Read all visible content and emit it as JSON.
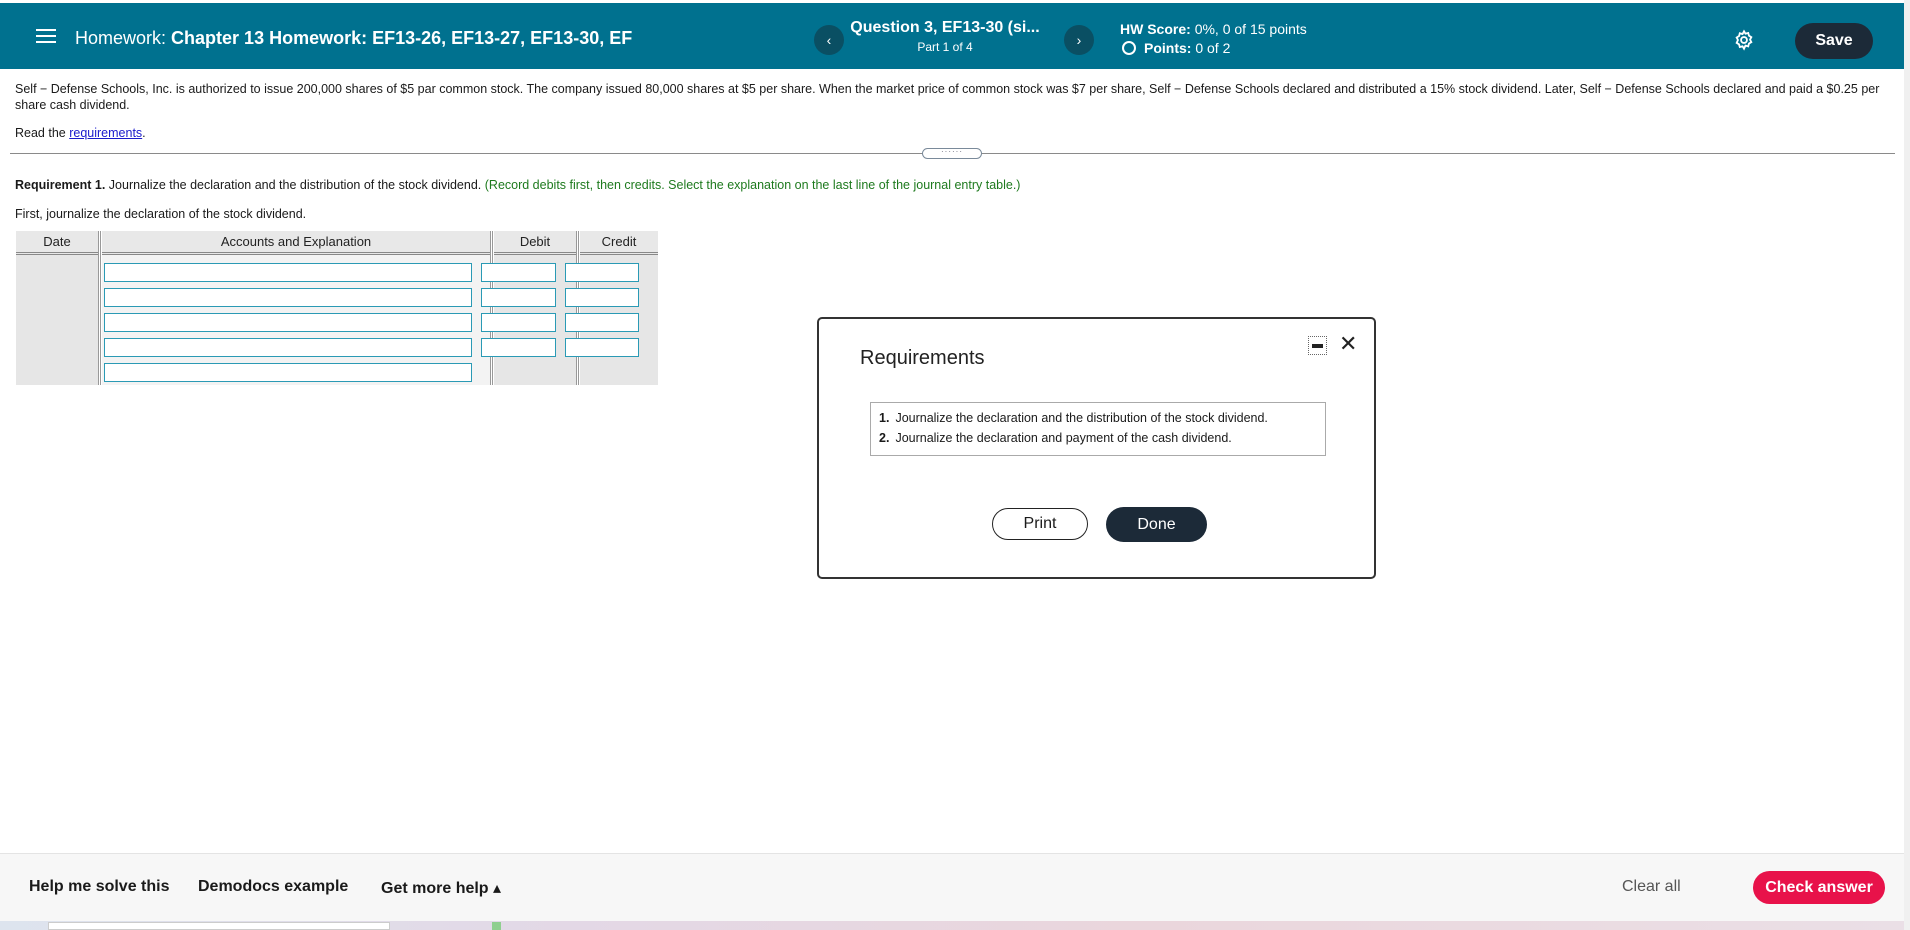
{
  "header": {
    "homework_label": "Homework:",
    "homework_title": "Chapter 13 Homework: EF13-26, EF13-27, EF13-30, EF",
    "prev_label": "‹",
    "next_label": "›",
    "question_title": "Question 3, EF13-30 (si...",
    "question_part": "Part 1 of 4",
    "hw_score_label": "HW Score:",
    "hw_score_value": "0%, 0 of 15 points",
    "points_label": "Points:",
    "points_value": "0 of 2",
    "save_label": "Save"
  },
  "problem": {
    "text": "Self − Defense Schools, Inc. is authorized to issue 200,000 shares of $5 par common stock. The company issued 80,000 shares at $5 per share. When the market price of common stock was $7 per share, Self − Defense Schools declared and distributed a 15% stock dividend. Later, Self − Defense Schools declared and paid a $0.25 per share cash dividend.",
    "read_prefix": "Read the",
    "read_link": "requirements",
    "read_suffix": ".",
    "drag_handle": "······"
  },
  "requirement1": {
    "label": "Requirement 1.",
    "text": "Journalize the declaration and the distribution of the stock dividend.",
    "hint": "(Record debits first, then credits. Select the explanation on the last line of the journal entry table.)",
    "first_line": "First, journalize the declaration of the stock dividend."
  },
  "journal": {
    "headers": {
      "date": "Date",
      "accounts": "Accounts and Explanation",
      "debit": "Debit",
      "credit": "Credit"
    },
    "rows": [
      {
        "account": "",
        "debit": "",
        "credit": ""
      },
      {
        "account": "",
        "debit": "",
        "credit": ""
      },
      {
        "account": "",
        "debit": "",
        "credit": ""
      },
      {
        "account": "",
        "debit": "",
        "credit": ""
      },
      {
        "account": ""
      }
    ]
  },
  "modal": {
    "title": "Requirements",
    "items": [
      {
        "num": "1.",
        "text": "Journalize the declaration and the distribution of the stock dividend."
      },
      {
        "num": "2.",
        "text": "Journalize the declaration and payment of the cash dividend."
      }
    ],
    "print_label": "Print",
    "done_label": "Done",
    "close_label": "✕"
  },
  "footer": {
    "help_solve": "Help me solve this",
    "demodocs": "Demodocs example",
    "more_help": "Get more help ▴",
    "clear_all": "Clear all",
    "check_answer": "Check answer"
  },
  "icons": {
    "menu": "menu-icon",
    "settings": "gear-icon",
    "minimize": "minimize-icon",
    "close": "close-icon"
  },
  "colors": {
    "header_bg": "#00718f",
    "save_bg": "#1c2a38",
    "check_answer_bg": "#e8124a",
    "hint_green": "#1e7a1e",
    "input_border": "#2a9ab5"
  }
}
